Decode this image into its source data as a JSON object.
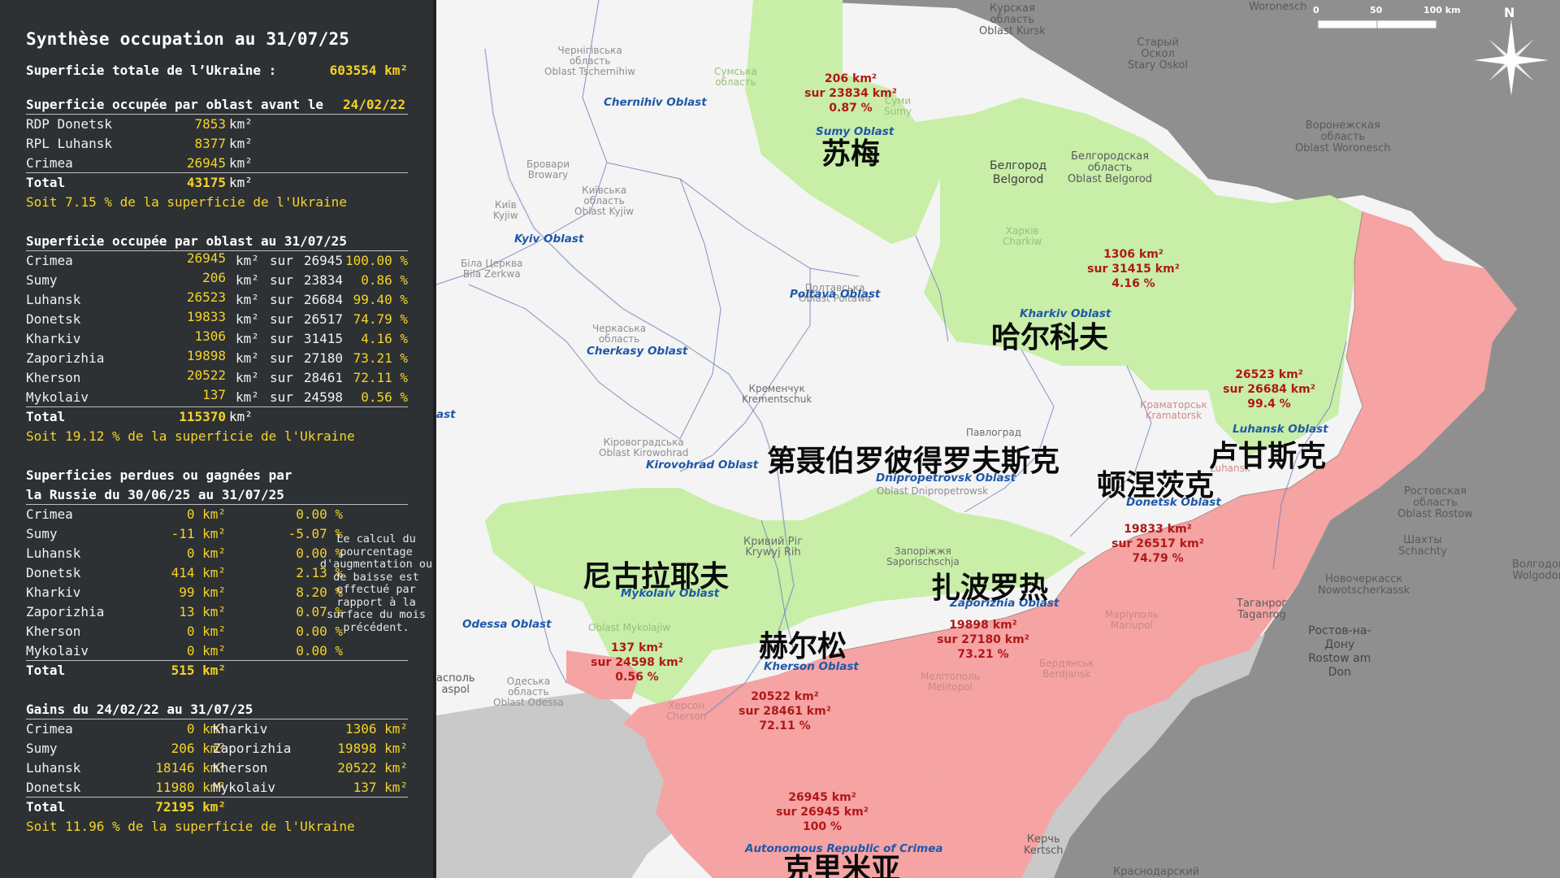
{
  "panel": {
    "title": "Synthèse occupation au 31/07/25",
    "total_label": "Superficie totale de l’Ukraine :",
    "total_value": "603554 km²",
    "before": {
      "heading_prefix": "Superficie occupée par oblast avant le",
      "heading_date": "24/02/22",
      "rows": [
        {
          "name": "RDP Donetsk",
          "value": "7853",
          "unit": "km²"
        },
        {
          "name": "RPL Luhansk",
          "value": "8377",
          "unit": "km²"
        },
        {
          "name": "Crimea",
          "value": "26945",
          "unit": "km²"
        }
      ],
      "total_label": "Total",
      "total_value": "43175",
      "total_unit": "km²",
      "summary": "Soit 7.15 % de la superficie de l'Ukraine"
    },
    "current": {
      "heading": "Superficie occupée par oblast au 31/07/25",
      "rows": [
        {
          "name": "Crimea",
          "value": "26945",
          "unit": "km²",
          "sur": "sur",
          "total": "26945",
          "pct": "100.00 %"
        },
        {
          "name": "Sumy",
          "value": "206",
          "unit": "km²",
          "sur": "sur",
          "total": "23834",
          "pct": "0.86 %"
        },
        {
          "name": "Luhansk",
          "value": "26523",
          "unit": "km²",
          "sur": "sur",
          "total": "26684",
          "pct": "99.40 %"
        },
        {
          "name": "Donetsk",
          "value": "19833",
          "unit": "km²",
          "sur": "sur",
          "total": "26517",
          "pct": "74.79 %"
        },
        {
          "name": "Kharkiv",
          "value": "1306",
          "unit": "km²",
          "sur": "sur",
          "total": "31415",
          "pct": "4.16 %"
        },
        {
          "name": "Zaporizhia",
          "value": "19898",
          "unit": "km²",
          "sur": "sur",
          "total": "27180",
          "pct": "73.21 %"
        },
        {
          "name": "Kherson",
          "value": "20522",
          "unit": "km²",
          "sur": "sur",
          "total": "28461",
          "pct": "72.11 %"
        },
        {
          "name": "Mykolaiv",
          "value": "137",
          "unit": "km²",
          "sur": "sur",
          "total": "24598",
          "pct": "0.56 %"
        }
      ],
      "total_label": "Total",
      "total_value": "115370",
      "total_unit": "km²",
      "summary": "Soit 19.12 % de la superficie de l'Ukraine"
    },
    "change": {
      "heading_line1": "Superficies perdues ou gagnées par",
      "heading_line2": "la Russie du 30/06/25 au 31/07/25",
      "rows": [
        {
          "name": "Crimea",
          "value": "0 km²",
          "pct": "0.00 %"
        },
        {
          "name": "Sumy",
          "value": "-11 km²",
          "pct": "-5.07 %"
        },
        {
          "name": "Luhansk",
          "value": "0 km²",
          "pct": "0.00 %"
        },
        {
          "name": "Donetsk",
          "value": "414 km²",
          "pct": "2.13 %"
        },
        {
          "name": "Kharkiv",
          "value": "99 km²",
          "pct": "8.20 %"
        },
        {
          "name": "Zaporizhia",
          "value": "13 km²",
          "pct": "0.07 %"
        },
        {
          "name": "Kherson",
          "value": "0 km²",
          "pct": "0.00 %"
        },
        {
          "name": "Mykolaiv",
          "value": "0 km²",
          "pct": "0.00 %"
        }
      ],
      "total_label": "Total",
      "total_value": "515 km²",
      "note": "Le calcul du pourcentage d'augmentation ou de baisse est effectué par rapport à la surface du mois précédent."
    },
    "gains": {
      "heading": "Gains du 24/02/22 au 31/07/25",
      "rows": [
        {
          "name1": "Crimea",
          "value1": "0 km²",
          "name2": "Kharkiv",
          "value2": "1306 km²"
        },
        {
          "name1": "Sumy",
          "value1": "206 km²",
          "name2": "Zaporizhia",
          "value2": "19898 km²"
        },
        {
          "name1": "Luhansk",
          "value1": "18146 km²",
          "name2": "Kherson",
          "value2": "20522 km²"
        },
        {
          "name1": "Donetsk",
          "value1": "11980 km²",
          "name2": "Mykolaiv",
          "value2": "137 km²"
        }
      ],
      "total_label": "Total",
      "total_value": "72195 km²",
      "summary": "Soit 11.96 % de la superficie de l'Ukraine"
    }
  },
  "map": {
    "colors": {
      "occupied": "#f5a3a3",
      "ukraine_held": "#c8eea8",
      "ukraine_other": "#f4f4f4",
      "foreign": "#8f8f8f",
      "sea": "#c9c9c9"
    },
    "scale": {
      "t0": "0",
      "t1": "50",
      "t2": "100 km"
    },
    "compass_letter": "N",
    "oblast_labels": {
      "chernihiv": "Chernihiv Oblast",
      "sumy": "Sumy Oblast",
      "kyiv": "Kyiv Oblast",
      "poltava": "Poltava Oblast",
      "kharkiv": "Kharkiv Oblast",
      "cherkasy": "Cherkasy Oblast",
      "luhansk": "Luhansk Oblast",
      "kirovohrad": "Kirovohrad Oblast",
      "dnipro": "Dnipropetrovsk Oblast",
      "donetsk": "Donetsk Oblast",
      "mykolaiv": "Mykolaiv Oblast",
      "zaporizhia": "Zaporizhia Oblast",
      "odessa": "Odessa Oblast",
      "kherson": "Kherson Oblast",
      "crimea": "Autonomous Republic of Crimea",
      "cut_left": "ast"
    },
    "chinese_labels": {
      "sumy": "苏梅",
      "kharkiv": "哈尔科夫",
      "dnipro": "第聂伯罗彼得罗夫斯克",
      "donetsk": "顿涅茨克",
      "luhansk": "卢甘斯克",
      "mykolaiv": "尼古拉耶夫",
      "zaporizhia": "扎波罗热",
      "kherson": "赫尔松",
      "crimea": "克里米亚"
    },
    "stats": {
      "sumy": [
        "206 km²",
        "sur 23834 km²",
        "0.87 %"
      ],
      "kharkiv": [
        "1306 km²",
        "sur 31415 km²",
        "4.16 %"
      ],
      "luhansk": [
        "26523 km²",
        "sur 26684 km²",
        "99.4 %"
      ],
      "donetsk": [
        "19833 km²",
        "sur 26517 km²",
        "74.79 %"
      ],
      "zaporizhia": [
        "19898 km²",
        "sur 27180 km²",
        "73.21 %"
      ],
      "kherson": [
        "20522 km²",
        "sur 28461 km²",
        "72.11 %"
      ],
      "mykolaiv": [
        "137 km²",
        "sur 24598 km²",
        "0.56 %"
      ],
      "crimea": [
        "26945 km²",
        "sur 26945 km²",
        "100 %"
      ]
    },
    "places": {
      "woronesch_top": "Woronesch",
      "kursk": [
        "Курская",
        "область",
        "Oblast Kursk"
      ],
      "stary_oskol": [
        "Старый",
        "Оскол",
        "Stary Oskol"
      ],
      "belgorod_city": [
        "Белгород",
        "Belgorod"
      ],
      "belgorod_oblast": [
        "Белгородская",
        "область",
        "Oblast Belgorod"
      ],
      "voronezh_oblast": [
        "Воронежская",
        "область",
        "Oblast Woronesch"
      ],
      "chernihiv_local": [
        "Чернігівська",
        "область",
        "Oblast Tschernihiw"
      ],
      "sumy_local": [
        "Сумська",
        "область"
      ],
      "sumy_city": [
        "Суми",
        "Sumy"
      ],
      "brovary": [
        "Бровари",
        "Browary"
      ],
      "kyiv_city": [
        "Київ",
        "Kyjiw"
      ],
      "kyiv_local": [
        "Київська",
        "область",
        "Oblast Kyjiw"
      ],
      "bila_tserkva": [
        "Біла Церква",
        "Bila Zerkwa"
      ],
      "poltava_local": [
        "Полтавська",
        "Oblast Poltawa"
      ],
      "kharkiv_local": [
        "Харків",
        "Charkiw"
      ],
      "cherkasy_local": [
        "Черкаська",
        "область"
      ],
      "kremenchuk": [
        "Кременчук",
        "Krementschuk"
      ],
      "pavlohrad": "Павлоград",
      "kramatorsk": [
        "Краматорськ",
        "Kramatorsk"
      ],
      "kirovohrad_local": [
        "Кіровоградська",
        "Oblast Kirowohrad"
      ],
      "dnipro_local": "Oblast Dnipropetrowsk",
      "kryvyi_rih": [
        "Кривий Рiг",
        "Krywyj Rih"
      ],
      "zaporizhia_city": [
        "Запоріжжя",
        "Saporischschja"
      ],
      "mykolaiv_local": "Oblast Mykolajiw",
      "odesa_local": [
        "Одеська",
        "область",
        "Oblast Odessa"
      ],
      "kherson_city": [
        "Херсон",
        "Cherson"
      ],
      "melitopol": [
        "Мелітополь",
        "Melitopol"
      ],
      "mariupol": [
        "Маріуполь",
        "Mariupol"
      ],
      "berdiansk": [
        "Бердянськ",
        "Berdjansk"
      ],
      "rostov_oblast": [
        "Ростовская",
        "область",
        "Oblast Rostow"
      ],
      "shakhty": [
        "Шахты",
        "Schachty"
      ],
      "volgodonsk": [
        "Волгодон",
        "Wolgodon"
      ],
      "novocherkassk": [
        "Новочеркасск",
        "Nowotscherkassk"
      ],
      "taganrog": [
        "Таганрог",
        "Taganrog"
      ],
      "rostov_city": [
        "Ростов-на-",
        "Дону",
        "Rostow am",
        "Don"
      ],
      "kerch": [
        "Керчь",
        "Kertsch"
      ],
      "krasnodar": "Краснодарский",
      "sevastopol_cut": [
        "асполь",
        "aspol"
      ],
      "luhansk_local": "Luhansk"
    }
  }
}
